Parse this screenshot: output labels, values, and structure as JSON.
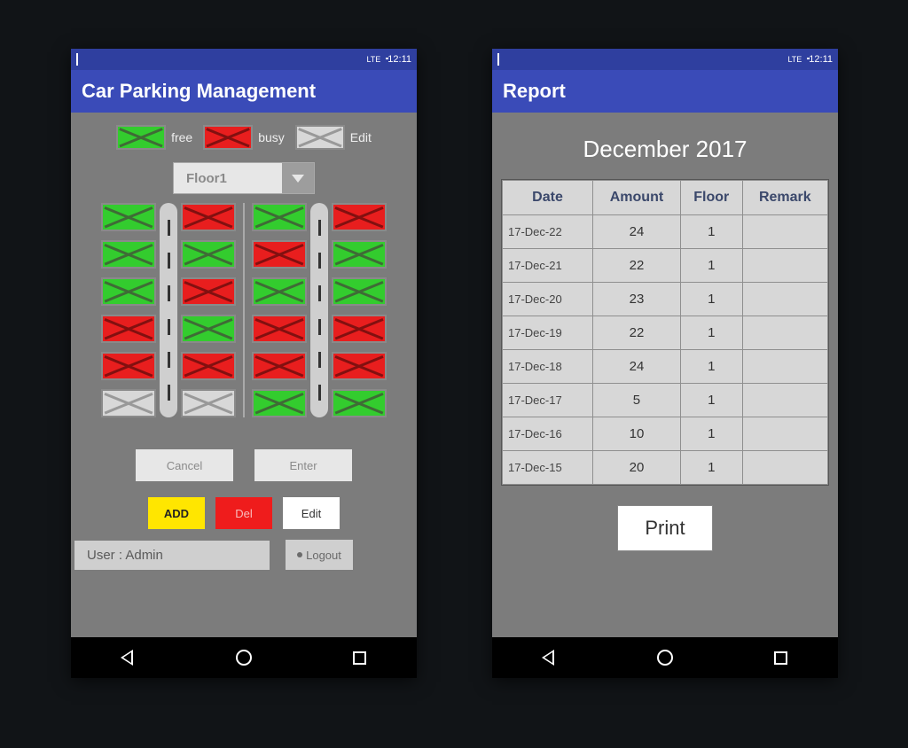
{
  "statusbar": {
    "time": "12:11",
    "signal": "LTE"
  },
  "left": {
    "title": "Car Parking Management",
    "legend": {
      "free": "free",
      "busy": "busy",
      "edit": "Edit"
    },
    "floor_select": "Floor1",
    "slots": {
      "left_half": {
        "colA": [
          "free",
          "free",
          "free",
          "busy",
          "busy",
          "edit"
        ],
        "colB": [
          "busy",
          "free",
          "busy",
          "free",
          "busy",
          "edit"
        ]
      },
      "right_half": {
        "colA": [
          "free",
          "busy",
          "free",
          "busy",
          "busy",
          "free"
        ],
        "colB": [
          "busy",
          "free",
          "free",
          "busy",
          "busy",
          "free"
        ]
      }
    },
    "buttons": {
      "cancel": "Cancel",
      "enter": "Enter",
      "add": "ADD",
      "del": "Del",
      "edit": "Edit"
    },
    "user_label": "User : Admin",
    "logout": "Logout"
  },
  "right": {
    "title": "Report",
    "period": "December 2017",
    "columns": [
      "Date",
      "Amount",
      "Floor",
      "Remark"
    ],
    "rows": [
      {
        "date": "17-Dec-22",
        "amount": "24",
        "floor": "1",
        "remark": ""
      },
      {
        "date": "17-Dec-21",
        "amount": "22",
        "floor": "1",
        "remark": ""
      },
      {
        "date": "17-Dec-20",
        "amount": "23",
        "floor": "1",
        "remark": ""
      },
      {
        "date": "17-Dec-19",
        "amount": "22",
        "floor": "1",
        "remark": ""
      },
      {
        "date": "17-Dec-18",
        "amount": "24",
        "floor": "1",
        "remark": ""
      },
      {
        "date": "17-Dec-17",
        "amount": "5",
        "floor": "1",
        "remark": ""
      },
      {
        "date": "17-Dec-16",
        "amount": "10",
        "floor": "1",
        "remark": ""
      },
      {
        "date": "17-Dec-15",
        "amount": "20",
        "floor": "1",
        "remark": ""
      }
    ],
    "print": "Print"
  }
}
